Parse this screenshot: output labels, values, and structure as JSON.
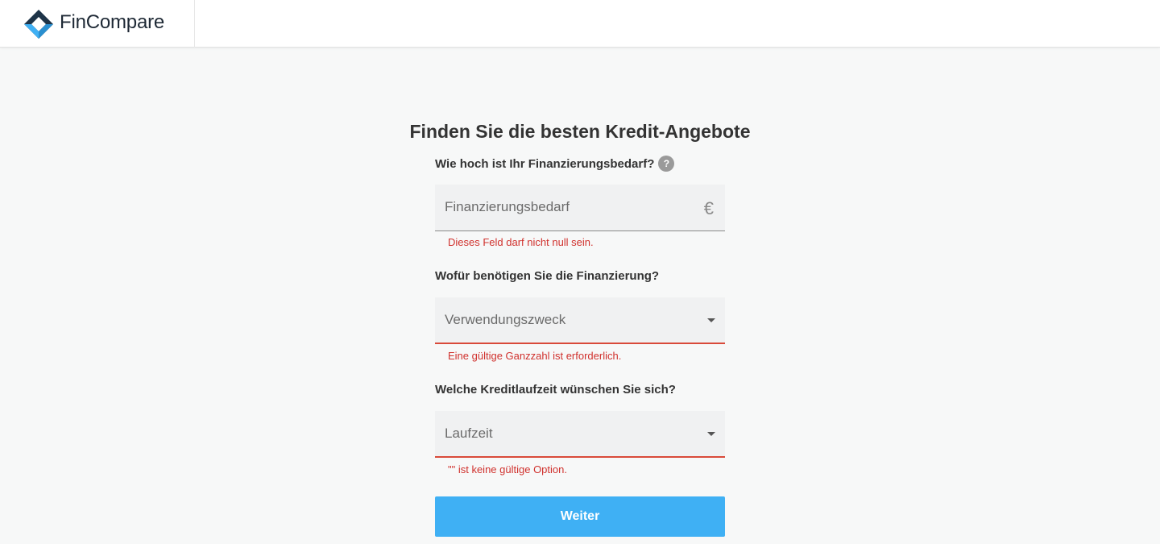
{
  "header": {
    "brand_name": "FinCompare",
    "logo_colors": {
      "dark": "#1e3448",
      "accent": "#3fb0f4"
    }
  },
  "form": {
    "title": "Finden Sie die besten Kredit-Angebote",
    "questions": [
      {
        "label": "Wie hoch ist Ihr Finanzierungsbedarf?",
        "help_icon": "?",
        "placeholder": "Finanzierungsbedarf",
        "suffix": "€",
        "error": "Dieses Feld darf nicht null sein."
      },
      {
        "label": "Wofür benötigen Sie die Finanzierung?",
        "placeholder": "Verwendungszweck",
        "error": "Eine gültige Ganzzahl ist erforderlich."
      },
      {
        "label": "Welche Kreditlaufzeit wünschen Sie sich?",
        "placeholder": "Laufzeit",
        "error": "\"\" ist keine gültige Option."
      }
    ],
    "submit_label": "Weiter"
  },
  "colors": {
    "primary_button": "#3fb0f4",
    "error": "#d0312d",
    "background": "#f7f8f8"
  }
}
